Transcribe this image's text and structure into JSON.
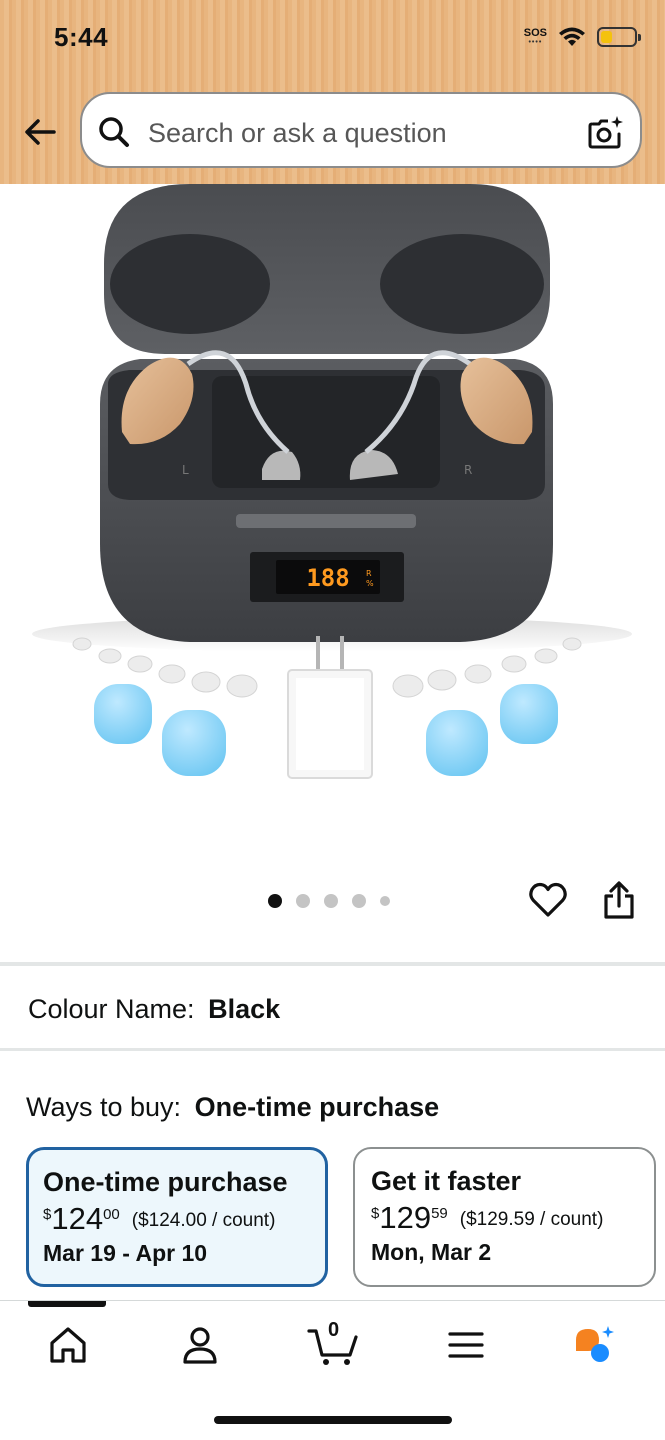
{
  "status_bar": {
    "time": "5:44",
    "sos_label": "SOS",
    "battery_level": 0.35,
    "battery_color": "#f4c20d"
  },
  "header": {
    "background_color": "#e8b57f",
    "search": {
      "placeholder": "Search or ask a question",
      "icon": "search-icon",
      "camera_icon": "camera-lens-icon"
    },
    "back_icon": "back-arrow-icon"
  },
  "product_image": {
    "display_text": "188",
    "led_labels": [
      "L",
      "R",
      "%"
    ]
  },
  "carousel": {
    "total_images": 5,
    "active_index": 0,
    "icons": [
      "heart-icon",
      "share-icon"
    ]
  },
  "colour": {
    "label": "Colour Name:",
    "value": "Black"
  },
  "ways_to_buy": {
    "label": "Ways to buy:",
    "selected": "One-time purchase",
    "options": [
      {
        "title": "One-time purchase",
        "currency": "$",
        "price_whole": "124",
        "price_fraction": "00",
        "unit_price": "($124.00 / count)",
        "delivery": "Mar 19 - Apr 10",
        "selected": true
      },
      {
        "title": "Get it faster",
        "currency": "$",
        "price_whole": "129",
        "price_fraction": "59",
        "unit_price": "($129.59 / count)",
        "delivery": "Mon, Mar 2",
        "selected": false
      }
    ]
  },
  "bottom_nav": {
    "items": [
      "home-icon",
      "account-icon",
      "cart-icon",
      "menu-icon",
      "rufus-assistant-icon"
    ],
    "cart_count": "0",
    "active_index": 0,
    "accent_colors": [
      "#f58220",
      "#1a8cff"
    ]
  }
}
